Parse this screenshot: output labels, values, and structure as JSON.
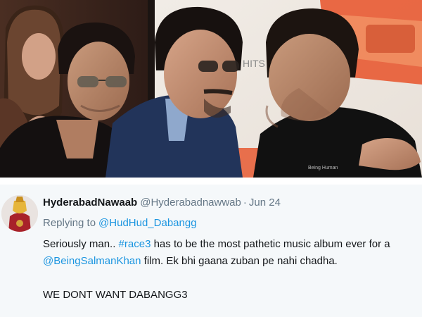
{
  "tweet": {
    "display_name": "HyderabadNawaab",
    "handle": "@Hyderabadnawwab",
    "separator": "·",
    "date": "Jun 24",
    "replying_prefix": "Replying to",
    "replying_handle": "@HudHud_Dabangg",
    "text": {
      "line1_before": "Seriously man.. ",
      "hashtag": "#race3",
      "line1_after": " has to be the most pathetic music album ever for a",
      "mention": "@BeingSalmanKhan",
      "line2_after": " film. Ek bhi gaana zuban pe nahi chadha.",
      "line3": "WE DONT WANT DABANGG3"
    }
  },
  "photo": {
    "backdrop_text": "HITS",
    "shirt_tag": "Being Human"
  },
  "colors": {
    "link": "#1b95e0",
    "secondary_text": "#657786",
    "primary_text": "#14171a",
    "tweet_background": "#f5f8fa"
  }
}
